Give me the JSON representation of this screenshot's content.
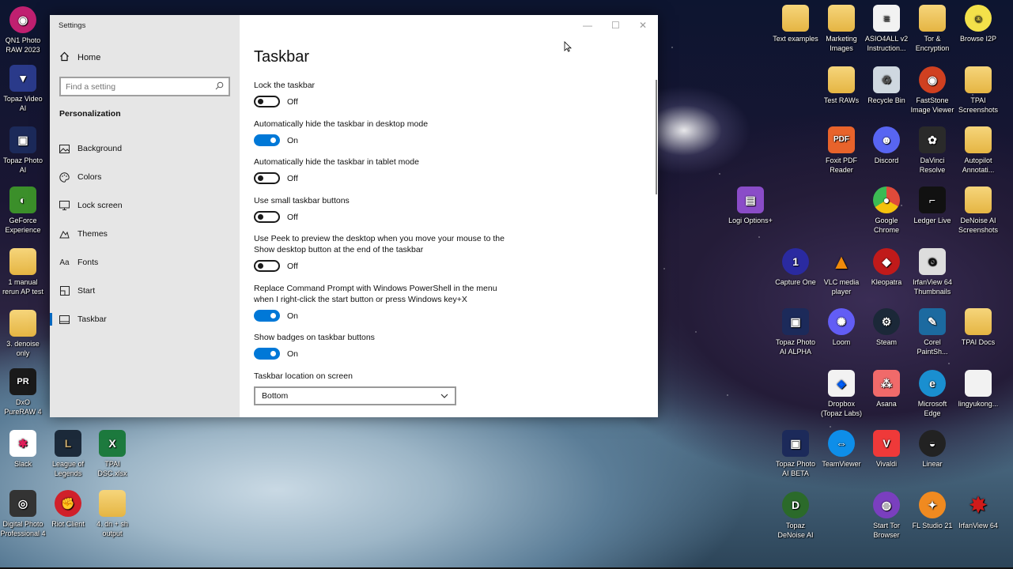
{
  "window": {
    "title": "Settings",
    "home_label": "Home",
    "search_placeholder": "Find a setting",
    "section": "Personalization",
    "nav": [
      {
        "label": "Background",
        "icon": "picture-icon"
      },
      {
        "label": "Colors",
        "icon": "palette-icon"
      },
      {
        "label": "Lock screen",
        "icon": "monitor-icon"
      },
      {
        "label": "Themes",
        "icon": "themes-icon"
      },
      {
        "label": "Fonts",
        "icon": "fonts-icon"
      },
      {
        "label": "Start",
        "icon": "start-icon"
      },
      {
        "label": "Taskbar",
        "icon": "taskbar-icon",
        "active": true
      }
    ]
  },
  "page": {
    "title": "Taskbar",
    "settings": [
      {
        "label": "Lock the taskbar",
        "state": "Off",
        "on": false
      },
      {
        "label": "Automatically hide the taskbar in desktop mode",
        "state": "On",
        "on": true
      },
      {
        "label": "Automatically hide the taskbar in tablet mode",
        "state": "Off",
        "on": false
      },
      {
        "label": "Use small taskbar buttons",
        "state": "Off",
        "on": false
      },
      {
        "label": "Use Peek to preview the desktop when you move your mouse to the Show desktop button at the end of the taskbar",
        "state": "Off",
        "on": false
      },
      {
        "label": "Replace Command Prompt with Windows PowerShell in the menu when I right-click the start button or press Windows key+X",
        "state": "On",
        "on": true
      },
      {
        "label": "Show badges on taskbar buttons",
        "state": "On",
        "on": true
      }
    ],
    "location_label": "Taskbar location on screen",
    "location_value": "Bottom"
  },
  "desktop": {
    "left_icons": [
      {
        "label": "QN1 Photo RAW 2023",
        "color": "#c02070"
      },
      {
        "label": "Topaz Video AI",
        "color": "#2a3a8a"
      },
      {
        "label": "Topaz Photo AI",
        "color": "#1c2a5a"
      },
      {
        "label": "GeForce Experience",
        "color": "#3b8f2a"
      },
      {
        "label": "1 manual rerun AP test",
        "color": "#e5b543"
      },
      {
        "label": "3. denoise only",
        "color": "#e5b543"
      },
      {
        "label": "DxO PureRAW 4",
        "color": "#1a1a1a"
      },
      {
        "label": "Slack",
        "color": "#ffffff"
      },
      {
        "label": "League of Legends",
        "color": "#1c2a3a"
      },
      {
        "label": "TPAI DSC.xlsx",
        "color": "#1d7a3e"
      },
      {
        "label": "Digital Photo Professional 4",
        "color": "#333333"
      },
      {
        "label": "Riot Client",
        "color": "#d0202a"
      },
      {
        "label": "4. dn + sh output",
        "color": "#e5b543"
      }
    ],
    "right_icons": [
      {
        "label": "Text examples",
        "color": "#e5b543"
      },
      {
        "label": "Marketing Images",
        "color": "#e5b543"
      },
      {
        "label": "ASIO4ALL v2 Instruction...",
        "color": "#f2f2f2"
      },
      {
        "label": "Tor & Encryption",
        "color": "#e5b543"
      },
      {
        "label": "Browse I2P",
        "color": "#f3e14a"
      },
      {
        "label": "Test RAWs",
        "color": "#e5b543"
      },
      {
        "label": "Recycle Bin",
        "color": "#cfd8e0"
      },
      {
        "label": "FastStone Image Viewer",
        "color": "#d04020"
      },
      {
        "label": "TPAI Screenshots",
        "color": "#e5b543"
      },
      {
        "label": "Foxit PDF Reader",
        "color": "#e8632b"
      },
      {
        "label": "Discord",
        "color": "#5865f2"
      },
      {
        "label": "DaVinci Resolve",
        "color": "#2a2a2a"
      },
      {
        "label": "Autopilot Annotati...",
        "color": "#e5b543"
      },
      {
        "label": "Logi Options+",
        "color": "#8a4cc8"
      },
      {
        "label": "Google Chrome",
        "color": "#e04a3a"
      },
      {
        "label": "Ledger Live",
        "color": "#111111"
      },
      {
        "label": "DeNoise AI Screenshots",
        "color": "#e5b543"
      },
      {
        "label": "Capture One",
        "color": "#2a2aa0"
      },
      {
        "label": "VLC media player",
        "color": "#f08a0a"
      },
      {
        "label": "Kleopatra",
        "color": "#c01a1a"
      },
      {
        "label": "IrfanView 64 Thumbnails",
        "color": "#dddddd"
      },
      {
        "label": "Topaz Photo AI ALPHA",
        "color": "#1c2a5a"
      },
      {
        "label": "Loom",
        "color": "#625df5"
      },
      {
        "label": "Steam",
        "color": "#1b2838"
      },
      {
        "label": "Corel PaintSh...",
        "color": "#1c6aa0"
      },
      {
        "label": "TPAI Docs",
        "color": "#e5b543"
      },
      {
        "label": "Dropbox (Topaz Labs)",
        "color": "#f2f2f2"
      },
      {
        "label": "Asana",
        "color": "#f06a6a"
      },
      {
        "label": "Microsoft Edge",
        "color": "#1a8fd0"
      },
      {
        "label": "lingyukong...",
        "color": "#f2f2f2"
      },
      {
        "label": "Topaz Photo AI BETA",
        "color": "#1c2a5a"
      },
      {
        "label": "TeamViewer",
        "color": "#0e8ee9"
      },
      {
        "label": "Vivaldi",
        "color": "#ef3939"
      },
      {
        "label": "Linear",
        "color": "#222222"
      },
      {
        "label": "Topaz DeNoise AI",
        "color": "#2b6a2a"
      },
      {
        "label": "Start Tor Browser",
        "color": "#7a3fbf"
      },
      {
        "label": "FL Studio 21",
        "color": "#f08a20"
      },
      {
        "label": "IrfanView 64",
        "color": "#d01a1a"
      }
    ]
  }
}
